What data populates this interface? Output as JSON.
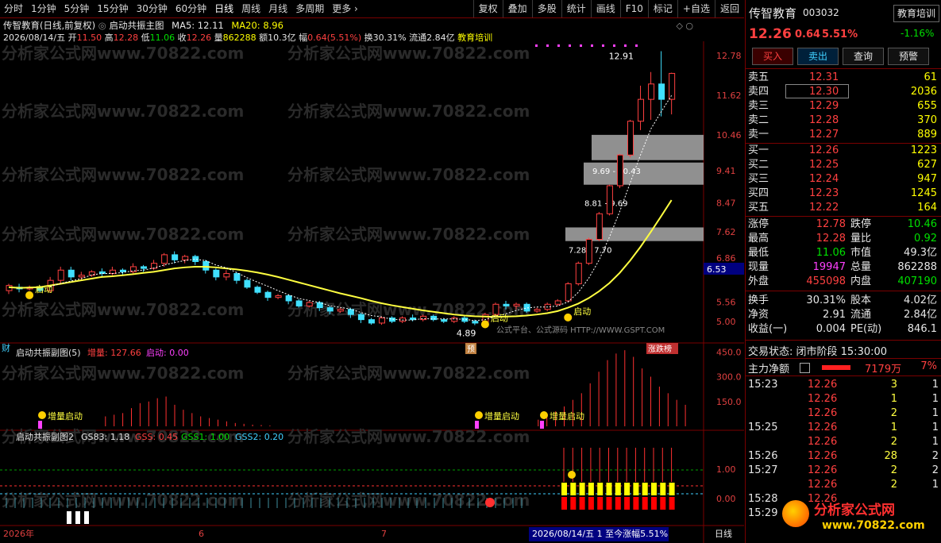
{
  "toolbar": {
    "left": [
      "分时",
      "1分钟",
      "5分钟",
      "15分钟",
      "30分钟",
      "60分钟",
      "日线",
      "周线",
      "月线",
      "多周期",
      "更多"
    ],
    "right": [
      "复权",
      "叠加",
      "多股",
      "统计",
      "画线",
      "F10",
      "标记",
      "+自选",
      "返回"
    ]
  },
  "main_header": {
    "title": "传智教育(日线,前复权)",
    "indicator": "启动共振主图",
    "ma5": "MA5: 12.11",
    "ma20": "MA20: 8.96",
    "date": "2026/08/14/五",
    "open_label": "开",
    "open": "11.50",
    "high_label": "高",
    "high": "12.28",
    "low_label": "低",
    "low": "11.06",
    "close_label": "收",
    "close": "12.26",
    "vol_label": "量",
    "vol": "862288",
    "amt_label": "额",
    "amt": "10.3亿",
    "amp_label": "幅",
    "amp": "0.64(5.51%)",
    "turn_label": "换",
    "turn": "30.31%",
    "float_label": "流通",
    "float": "2.84亿",
    "concept": "教育培训"
  },
  "main_axis": [
    "12.78",
    "11.62",
    "10.46",
    "9.41",
    "8.47",
    "7.62",
    "6.86",
    "6.53",
    "5.56",
    "5.00"
  ],
  "main_annotations": {
    "high_mark": "12.91",
    "low_mark": "4.89",
    "start_text": "启动",
    "zone1": "9.69 - 10.43",
    "zone2": "8.81 - 9.69",
    "zone3": "7.28 - 7.70",
    "bottom_left": "财",
    "bottom_pre": "预",
    "bottom_limit": "涨跌榜",
    "watermark": "分析家公式网www.70822.com",
    "platform": "公式平台、公式源码 HTTP://WWW.GSPT.COM"
  },
  "sub1": {
    "title": "启动共振副图(5)",
    "zl_label": "增量: 127.66",
    "qd_label": "启动: 0.00",
    "axis": [
      "450.0",
      "300.0",
      "150.0"
    ],
    "signal": "增量启动"
  },
  "sub2": {
    "title": "启动共振副图2",
    "gs3": "GS83: 1.18",
    "gss": "GSS: 0.45",
    "gss1": "GSS1: 1.00",
    "gss2": "GSS2: 0.20",
    "axis": [
      "1.00",
      "0.00"
    ]
  },
  "xaxis": {
    "labels": [
      "2026年",
      "6",
      "7"
    ],
    "status": "2026/08/14/五 1 至今涨幅5.51%",
    "period": "日线"
  },
  "quote": {
    "name": "传智教育",
    "code": "003032",
    "sector": "教育培训",
    "sector_pct": "-1.16%",
    "price": "12.26",
    "chg": "0.64",
    "pct": "5.51%",
    "buttons": [
      "买入",
      "卖出",
      "查询",
      "预警"
    ],
    "asks": [
      {
        "label": "卖五",
        "price": "12.31",
        "vol": "61"
      },
      {
        "label": "卖四",
        "price": "12.30",
        "vol": "2036"
      },
      {
        "label": "卖三",
        "price": "12.29",
        "vol": "655"
      },
      {
        "label": "卖二",
        "price": "12.28",
        "vol": "370"
      },
      {
        "label": "卖一",
        "price": "12.27",
        "vol": "889"
      }
    ],
    "bids": [
      {
        "label": "买一",
        "price": "12.26",
        "vol": "1223"
      },
      {
        "label": "买二",
        "price": "12.25",
        "vol": "627"
      },
      {
        "label": "买三",
        "price": "12.24",
        "vol": "947"
      },
      {
        "label": "买四",
        "price": "12.23",
        "vol": "1245"
      },
      {
        "label": "买五",
        "price": "12.22",
        "vol": "164"
      }
    ],
    "stats": [
      {
        "l": "涨停",
        "v": "12.78",
        "l2": "跌停",
        "v2": "10.46"
      },
      {
        "l": "最高",
        "v": "12.28",
        "l2": "量比",
        "v2": "0.92"
      },
      {
        "l": "最低",
        "v": "11.06",
        "l2": "市值",
        "v2": "49.3亿"
      },
      {
        "l": "现量",
        "v": "19947",
        "l2": "总量",
        "v2": "862288"
      },
      {
        "l": "外盘",
        "v": "455098",
        "l2": "内盘",
        "v2": "407190"
      }
    ],
    "stats2": [
      {
        "l": "换手",
        "v": "30.31%",
        "l2": "股本",
        "v2": "4.02亿"
      },
      {
        "l": "净资",
        "v": "2.91",
        "l2": "流通",
        "v2": "2.84亿"
      },
      {
        "l": "收益(一)",
        "v": "0.004",
        "l2": "PE(动)",
        "v2": "846.1"
      }
    ],
    "trade_status": "交易状态: 闭市阶段 15:30:00",
    "main_flow_label": "主力净额",
    "main_flow": "7179万",
    "main_flow_pct": "7%",
    "ticks": [
      {
        "t": "15:23",
        "p": "12.26",
        "v": "3",
        "n": "1"
      },
      {
        "t": "",
        "p": "12.26",
        "v": "1",
        "n": "1"
      },
      {
        "t": "",
        "p": "12.26",
        "v": "2",
        "n": "1"
      },
      {
        "t": "15:25",
        "p": "12.26",
        "v": "1",
        "n": "1"
      },
      {
        "t": "",
        "p": "12.26",
        "v": "2",
        "n": "1"
      },
      {
        "t": "15:26",
        "p": "12.26",
        "v": "28",
        "n": "2"
      },
      {
        "t": "15:27",
        "p": "12.26",
        "v": "2",
        "n": "2"
      },
      {
        "t": "",
        "p": "12.26",
        "v": "2",
        "n": "1"
      },
      {
        "t": "15:28",
        "p": "12.26",
        "v": "",
        "n": ""
      },
      {
        "t": "15:29",
        "p": "",
        "v": "",
        "n": ""
      }
    ],
    "logo": "分析家公式网",
    "logo_url": "www.70822.com"
  },
  "chart_data": {
    "type": "candlestick",
    "ylim": [
      4.6,
      13.2
    ],
    "candles": [
      [
        5.9,
        6.05,
        5.8,
        6.1
      ],
      [
        6.0,
        5.95,
        5.85,
        6.1
      ],
      [
        5.95,
        6.0,
        5.9,
        6.05
      ],
      [
        6.0,
        5.9,
        5.85,
        6.05
      ],
      [
        5.9,
        6.2,
        5.85,
        6.3
      ],
      [
        6.2,
        6.5,
        6.1,
        6.6
      ],
      [
        6.5,
        6.3,
        6.2,
        6.6
      ],
      [
        6.3,
        6.35,
        6.2,
        6.45
      ],
      [
        6.35,
        6.45,
        6.3,
        6.5
      ],
      [
        6.45,
        6.4,
        6.3,
        6.55
      ],
      [
        6.4,
        6.5,
        6.35,
        6.6
      ],
      [
        6.5,
        6.45,
        6.35,
        6.55
      ],
      [
        6.45,
        6.6,
        6.4,
        6.7
      ],
      [
        6.6,
        6.55,
        6.45,
        6.65
      ],
      [
        6.55,
        6.7,
        6.5,
        6.8
      ],
      [
        6.7,
        6.95,
        6.6,
        7.0
      ],
      [
        6.95,
        6.8,
        6.7,
        7.05
      ],
      [
        6.8,
        6.9,
        6.7,
        6.95
      ],
      [
        6.9,
        6.75,
        6.65,
        6.95
      ],
      [
        6.75,
        6.5,
        6.4,
        6.8
      ],
      [
        6.5,
        6.3,
        6.2,
        6.55
      ],
      [
        6.3,
        6.4,
        6.2,
        6.5
      ],
      [
        6.4,
        6.2,
        6.1,
        6.45
      ],
      [
        6.2,
        6.0,
        5.95,
        6.25
      ],
      [
        6.0,
        5.85,
        5.8,
        6.05
      ],
      [
        5.85,
        5.7,
        5.6,
        5.9
      ],
      [
        5.7,
        5.75,
        5.65,
        5.8
      ],
      [
        5.75,
        5.6,
        5.5,
        5.8
      ],
      [
        5.6,
        5.45,
        5.4,
        5.65
      ],
      [
        5.45,
        5.55,
        5.4,
        5.6
      ],
      [
        5.55,
        5.4,
        5.3,
        5.6
      ],
      [
        5.4,
        5.3,
        5.2,
        5.45
      ],
      [
        5.3,
        5.35,
        5.25,
        5.4
      ],
      [
        5.35,
        5.2,
        5.1,
        5.4
      ],
      [
        5.2,
        5.05,
        4.95,
        5.25
      ],
      [
        5.05,
        4.95,
        4.9,
        5.1
      ],
      [
        4.95,
        5.1,
        4.9,
        5.15
      ],
      [
        5.1,
        5.0,
        4.95,
        5.15
      ],
      [
        5.0,
        5.1,
        4.95,
        5.15
      ],
      [
        5.1,
        5.05,
        5.0,
        5.2
      ],
      [
        5.05,
        5.15,
        5.0,
        5.2
      ],
      [
        5.15,
        5.05,
        5.0,
        5.2
      ],
      [
        5.05,
        5.0,
        4.95,
        5.1
      ],
      [
        5.0,
        5.1,
        4.95,
        5.15
      ],
      [
        5.1,
        5.0,
        4.95,
        5.15
      ],
      [
        5.0,
        4.95,
        4.89,
        5.05
      ],
      [
        4.95,
        5.2,
        4.89,
        5.25
      ],
      [
        5.2,
        5.5,
        5.15,
        5.55
      ],
      [
        5.5,
        5.45,
        5.35,
        5.6
      ],
      [
        5.45,
        5.5,
        5.35,
        5.55
      ],
      [
        5.5,
        5.3,
        5.25,
        5.55
      ],
      [
        5.3,
        5.35,
        5.25,
        5.4
      ],
      [
        5.35,
        5.5,
        5.3,
        5.55
      ],
      [
        5.5,
        5.6,
        5.45,
        5.65
      ],
      [
        5.6,
        6.1,
        5.55,
        6.15
      ],
      [
        6.1,
        6.7,
        6.05,
        6.75
      ],
      [
        6.7,
        7.4,
        6.65,
        7.45
      ],
      [
        7.4,
        8.15,
        7.35,
        8.2
      ],
      [
        8.15,
        8.97,
        8.1,
        9.0
      ],
      [
        8.97,
        9.87,
        8.9,
        9.9
      ],
      [
        9.87,
        10.86,
        9.8,
        10.9
      ],
      [
        10.86,
        11.5,
        10.6,
        11.9
      ],
      [
        11.5,
        11.95,
        10.9,
        12.3
      ],
      [
        11.95,
        11.5,
        11.0,
        12.91
      ],
      [
        11.5,
        12.26,
        11.06,
        12.28
      ]
    ],
    "ma20": [
      6.0,
      5.98,
      5.99,
      6.0,
      6.05,
      6.1,
      6.15,
      6.2,
      6.25,
      6.3,
      6.32,
      6.35,
      6.38,
      6.42,
      6.45,
      6.5,
      6.55,
      6.58,
      6.6,
      6.6,
      6.58,
      6.55,
      6.52,
      6.48,
      6.43,
      6.37,
      6.3,
      6.22,
      6.14,
      6.06,
      5.98,
      5.9,
      5.82,
      5.75,
      5.68,
      5.6,
      5.53,
      5.47,
      5.42,
      5.37,
      5.32,
      5.28,
      5.24,
      5.2,
      5.17,
      5.15,
      5.14,
      5.13,
      5.14,
      5.15,
      5.17,
      5.2,
      5.24,
      5.3,
      5.4,
      5.52,
      5.68,
      5.88,
      6.12,
      6.42,
      6.78,
      7.18,
      7.62,
      8.08,
      8.55
    ],
    "vol1": [
      0,
      0,
      0,
      0,
      0,
      0,
      0,
      0,
      0,
      0,
      0,
      0,
      60,
      70,
      80,
      110,
      140,
      150,
      170,
      180,
      130,
      100,
      80,
      60,
      50,
      40,
      30,
      20,
      15,
      10,
      8,
      5,
      0,
      0,
      0,
      0,
      0,
      0,
      0,
      0,
      0,
      0,
      0,
      0,
      0,
      0,
      0,
      0,
      0,
      0,
      0,
      0,
      0,
      0,
      0,
      0,
      0,
      0,
      0,
      0,
      0,
      0,
      40,
      60,
      90,
      120,
      160,
      200,
      260,
      330,
      400,
      440,
      460,
      420,
      350,
      300,
      240,
      200,
      160,
      130
    ],
    "sub1_ylim": [
      0,
      480
    ]
  }
}
